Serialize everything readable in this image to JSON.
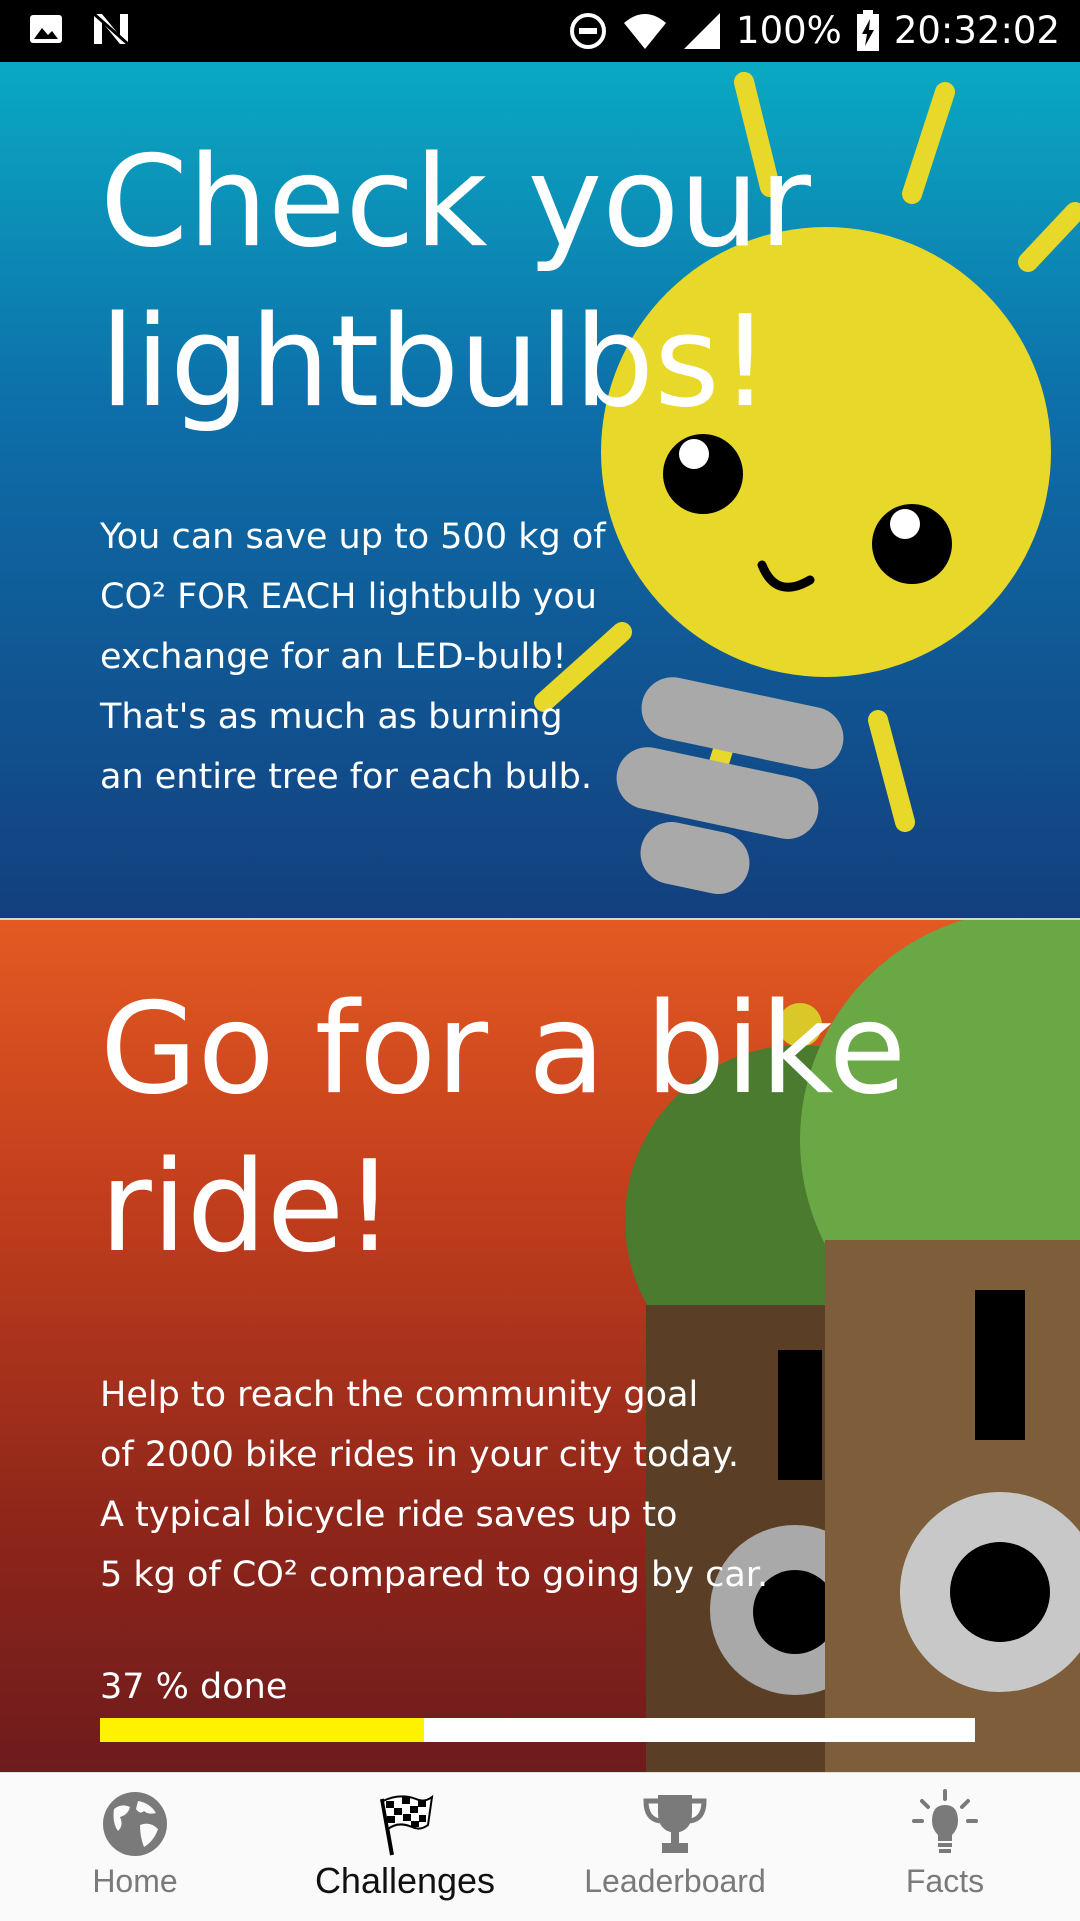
{
  "status_bar": {
    "battery": "100%",
    "time": "20:32:02",
    "icons": [
      "image-icon",
      "n-notification-icon",
      "do-not-disturb-icon",
      "wifi-icon",
      "cell-signal-icon",
      "battery-charging-icon"
    ]
  },
  "challenges": [
    {
      "title": "Check your lightbulbs!",
      "description": "You can save up to 500 kg of\nCO² FOR EACH lightbulb you\nexchange for an LED-bulb!\nThat's as much as burning\nan entire tree for each bulb."
    },
    {
      "title": "Go for a bike ride!",
      "description": "Help to reach the community goal\nof 2000 bike rides in your city today.\nA typical bicycle ride saves up to\n5 kg of CO² compared to going by car.",
      "progress_label": "37 % done",
      "progress": 0.37
    }
  ],
  "colors": {
    "progress_fill": "#fff200",
    "sun": "#e8d82a",
    "card1_top": "#0aa9c3",
    "card1_bottom": "#133f7e",
    "card2_top": "#e35a22",
    "card2_bottom": "#6d1b1c"
  },
  "bottom_nav": {
    "active": "Challenges",
    "items": [
      {
        "label": "Home",
        "icon": "globe-icon"
      },
      {
        "label": "Challenges",
        "icon": "checkered-flag-icon"
      },
      {
        "label": "Leaderboard",
        "icon": "trophy-icon"
      },
      {
        "label": "Facts",
        "icon": "lightbulb-icon"
      }
    ]
  }
}
